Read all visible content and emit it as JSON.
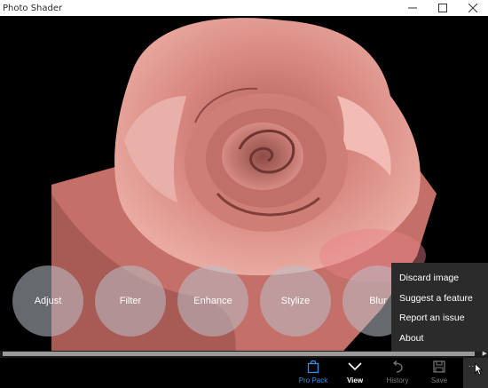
{
  "window": {
    "title": "Photo Shader"
  },
  "tools": [
    {
      "label": "Adjust"
    },
    {
      "label": "Filter"
    },
    {
      "label": "Enhance"
    },
    {
      "label": "Stylize"
    },
    {
      "label": "Blur"
    }
  ],
  "context_menu": {
    "items": [
      {
        "label": "Discard image"
      },
      {
        "label": "Suggest a feature"
      },
      {
        "label": "Report an issue"
      },
      {
        "label": "About"
      }
    ]
  },
  "app_bar": {
    "pro_pack": "Pro Pack",
    "view": "View",
    "history": "History",
    "save": "Save",
    "more": "..."
  },
  "colors": {
    "pro_pack_accent": "#2f8fe6",
    "rose": "#c97a72",
    "menu_bg": "#2b2b2b"
  },
  "icons": {
    "minimize": "minimize-icon",
    "maximize": "maximize-icon",
    "close": "close-icon",
    "pro_pack": "bag-icon",
    "view": "chevron-down-icon",
    "history": "undo-icon",
    "save": "save-icon",
    "more": "more-icon"
  }
}
